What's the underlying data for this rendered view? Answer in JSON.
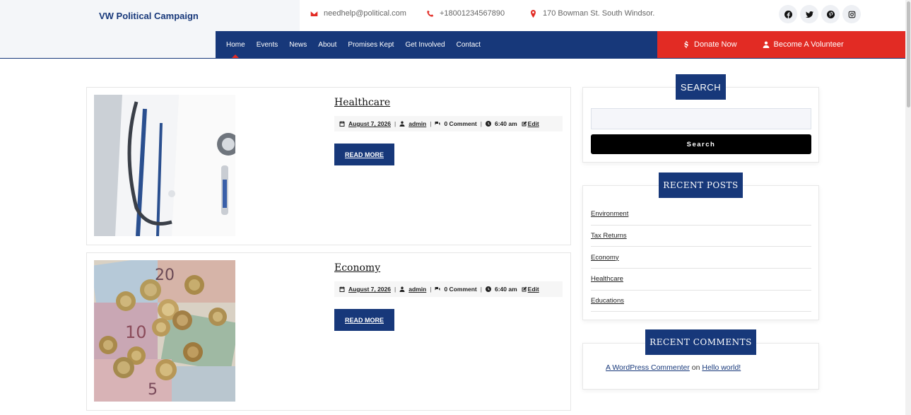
{
  "site": {
    "brand": "VW Political Campaign"
  },
  "topbar": {
    "email": "needhelp@political.com",
    "phone": "+18001234567890",
    "address": "170 Bowman St. South Windsor."
  },
  "socials": [
    "facebook-icon",
    "twitter-icon",
    "pinterest-icon",
    "instagram-icon"
  ],
  "nav": {
    "items": [
      "Home",
      "Events",
      "News",
      "About",
      "Promises Kept",
      "Get Involved",
      "Contact"
    ],
    "active": "Home"
  },
  "cta": {
    "donate": "Donate Now",
    "volunteer": "Become A Volunteer"
  },
  "posts": [
    {
      "title": "Healthcare",
      "date": "August 7, 2026",
      "author": "admin",
      "comments": "0 Comment",
      "time": "6:40 am",
      "edit": "Edit",
      "read_more": "READ MORE",
      "image": "doctor-stethoscope-image"
    },
    {
      "title": "Economy",
      "date": "August 7, 2026",
      "author": "admin",
      "comments": "0 Comment",
      "time": "6:40 am",
      "edit": "Edit",
      "read_more": "READ MORE",
      "image": "euro-coins-banknotes-image"
    }
  ],
  "sidebar": {
    "search": {
      "title": "SEARCH",
      "placeholder": "",
      "button": "Search"
    },
    "recent_posts": {
      "title": "RECENT POSTS",
      "items": [
        "Environment",
        "Tax Returns",
        "Economy",
        "Healthcare",
        "Educations"
      ]
    },
    "recent_comments": {
      "title": "RECENT COMMENTS",
      "author": "A WordPress Commenter",
      "on": "on",
      "post": "Hello world!"
    }
  },
  "colors": {
    "primary": "#17387a",
    "accent": "#e22b24",
    "button_dark": "#000000"
  }
}
